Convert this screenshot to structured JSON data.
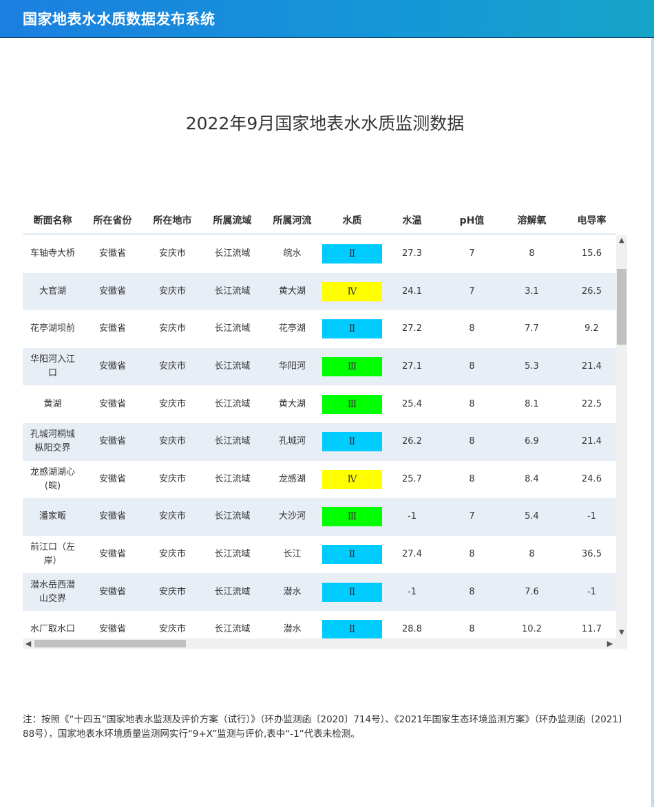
{
  "header": {
    "app_title": "国家地表水水质数据发布系统"
  },
  "page_title": "2022年9月国家地表水水质监测数据",
  "table": {
    "columns": [
      "断面名称",
      "所在省份",
      "所在地市",
      "所属流域",
      "所属河流",
      "水质",
      "水温",
      "pH值",
      "溶解氧",
      "电导率"
    ],
    "rows": [
      [
        "车轴寺大桥",
        "安徽省",
        "安庆市",
        "长江流域",
        "皖水",
        "Ⅱ",
        "27.3",
        "7",
        "8",
        "15.6"
      ],
      [
        "大官湖",
        "安徽省",
        "安庆市",
        "长江流域",
        "黄大湖",
        "Ⅳ",
        "24.1",
        "7",
        "3.1",
        "26.5"
      ],
      [
        "花亭湖坝前",
        "安徽省",
        "安庆市",
        "长江流域",
        "花亭湖",
        "Ⅱ",
        "27.2",
        "8",
        "7.7",
        "9.2"
      ],
      [
        "华阳河入江口",
        "安徽省",
        "安庆市",
        "长江流域",
        "华阳河",
        "Ⅲ",
        "27.1",
        "8",
        "5.3",
        "21.4"
      ],
      [
        "黄湖",
        "安徽省",
        "安庆市",
        "长江流域",
        "黄大湖",
        "Ⅲ",
        "25.4",
        "8",
        "8.1",
        "22.5"
      ],
      [
        "孔城河桐城枞阳交界",
        "安徽省",
        "安庆市",
        "长江流域",
        "孔城河",
        "Ⅱ",
        "26.2",
        "8",
        "6.9",
        "21.4"
      ],
      [
        "龙感湖湖心(皖)",
        "安徽省",
        "安庆市",
        "长江流域",
        "龙感湖",
        "Ⅳ",
        "25.7",
        "8",
        "8.4",
        "24.6"
      ],
      [
        "潘家畈",
        "安徽省",
        "安庆市",
        "长江流域",
        "大沙河",
        "Ⅲ",
        "-1",
        "7",
        "5.4",
        "-1"
      ],
      [
        "前江口（左岸）",
        "安徽省",
        "安庆市",
        "长江流域",
        "长江",
        "Ⅱ",
        "27.4",
        "8",
        "8",
        "36.5"
      ],
      [
        "潜水岳西潜山交界",
        "安徽省",
        "安庆市",
        "长江流域",
        "潜水",
        "Ⅱ",
        "-1",
        "8",
        "7.6",
        "-1"
      ],
      [
        "水厂取水口",
        "安徽省",
        "安庆市",
        "长江流域",
        "潜水",
        "Ⅱ",
        "28.8",
        "8",
        "10.2",
        "11.7"
      ]
    ]
  },
  "quality_colors": {
    "Ⅱ": "#00ccff",
    "Ⅲ": "#00ff00",
    "Ⅳ": "#ffff00"
  },
  "icons": {
    "scroll_up": "▲",
    "scroll_down": "▼",
    "scroll_left": "◀",
    "scroll_right": "▶"
  },
  "note": "注：按照《“十四五”国家地表水监测及评价方案（试行）》（环办监测函〔2020〕714号）、《2021年国家生态环境监测方案》（环办监测函〔2021〕88号），国家地表水环境质量监测网实行“9+X”监测与评价,表中“-1”代表未检测。"
}
